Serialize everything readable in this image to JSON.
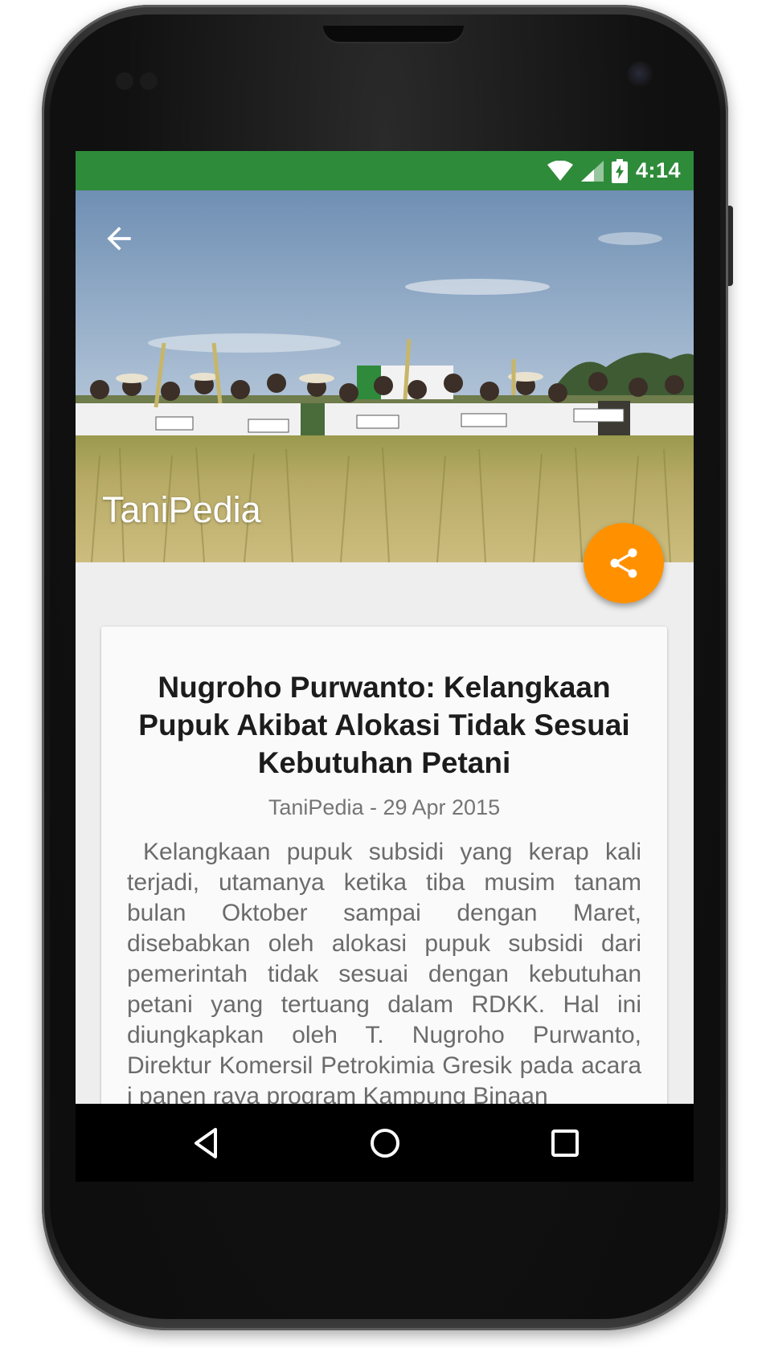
{
  "status_bar": {
    "time": "4:14",
    "icons": [
      "wifi-icon",
      "cell-signal-icon",
      "battery-charging-icon"
    ],
    "color": "#2e8b3a"
  },
  "header": {
    "title": "TaniPedia",
    "back_icon": "arrow-back-icon",
    "image": "farmers-holding-rice-in-paddy-field"
  },
  "fab": {
    "icon": "share-icon",
    "color": "#ff9100"
  },
  "article": {
    "title": "Nugroho Purwanto: Kelangkaan Pupuk Akibat Alokasi Tidak Sesuai Kebutuhan Petani",
    "meta": "TaniPedia - 29 Apr 2015",
    "body": "Kelangkaan pupuk subsidi yang kerap kali terjadi, utamanya ketika tiba musim tanam bulan Oktober sampai dengan Maret, disebabkan oleh alokasi pupuk subsidi dari pemerintah tidak sesuai dengan kebutuhan petani yang tertuang dalam RDKK. Hal ini diungkapkan oleh T. Nugroho Purwanto, Direktur Komersil Petrokimia Gresik pada acara i panen raya program Kampung Binaan"
  },
  "nav_bar": {
    "back_icon": "nav-back-icon",
    "home_icon": "nav-home-icon",
    "recents_icon": "nav-recents-icon"
  }
}
